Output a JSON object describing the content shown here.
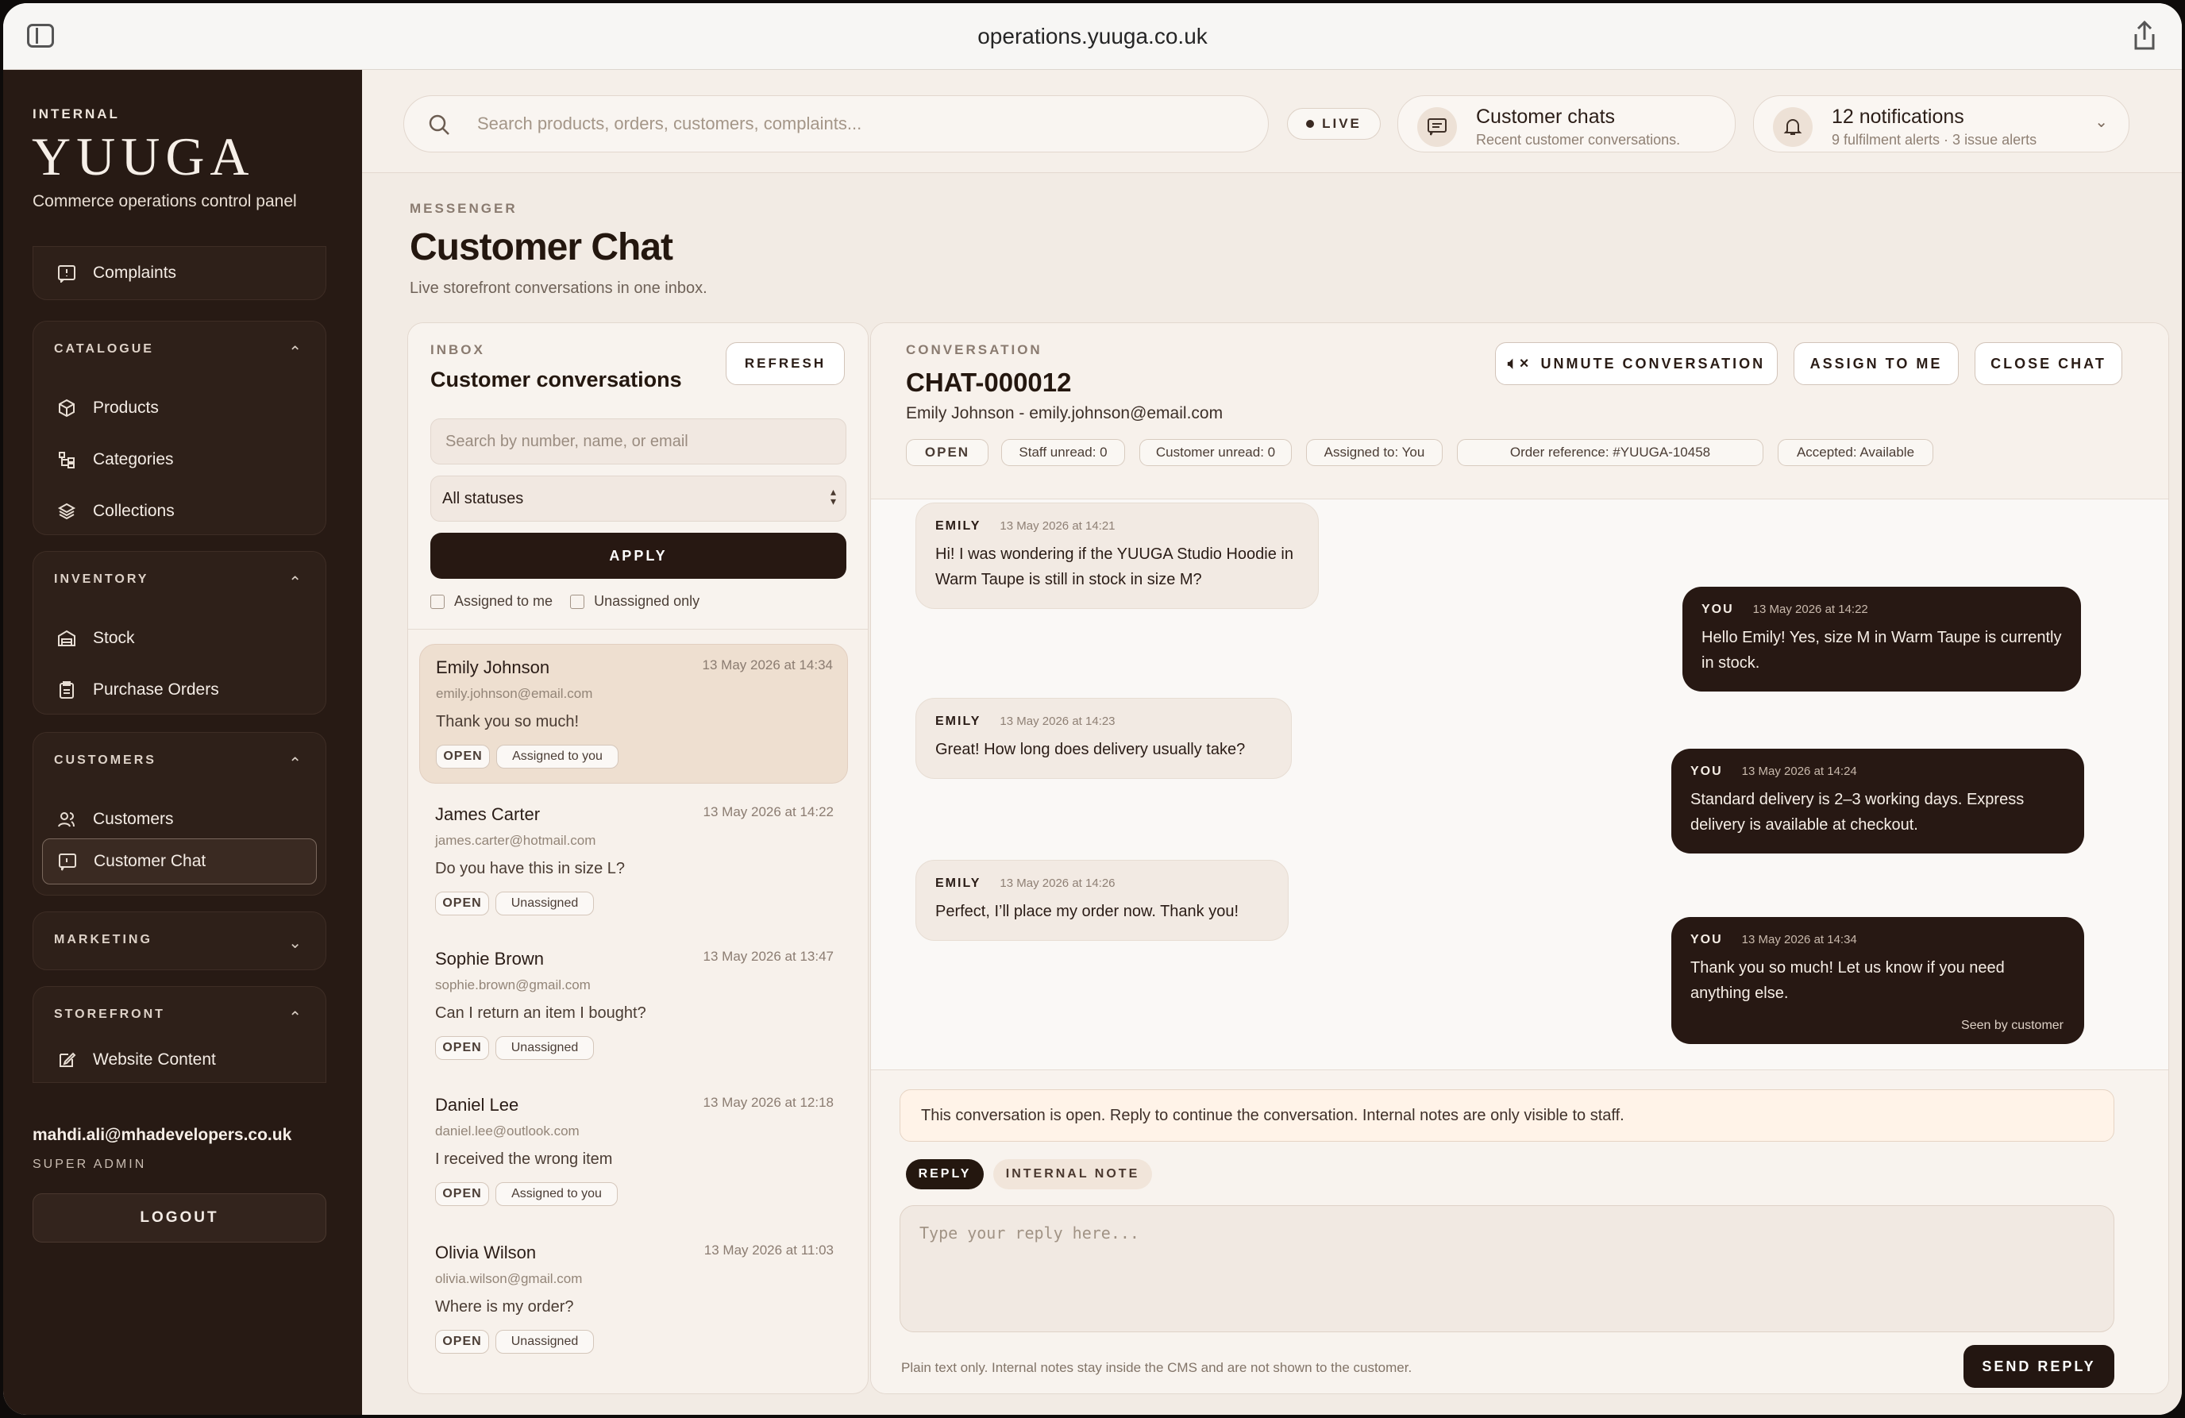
{
  "browser": {
    "url": "operations.yuuga.co.uk"
  },
  "brand": {
    "internal": "INTERNAL",
    "name": "YUUGA",
    "tagline": "Commerce operations control panel"
  },
  "sidebar": {
    "complaints": "Complaints",
    "catalogue": {
      "title": "CATALOGUE",
      "items": [
        "Products",
        "Categories",
        "Collections"
      ]
    },
    "inventory": {
      "title": "INVENTORY",
      "items": [
        "Stock",
        "Purchase Orders"
      ]
    },
    "customers": {
      "title": "CUSTOMERS",
      "items": [
        "Customers",
        "Customer Chat"
      ]
    },
    "marketing": {
      "title": "MARKETING"
    },
    "storefront": {
      "title": "STOREFRONT",
      "items": [
        "Website Content"
      ]
    },
    "user": {
      "email": "mahdi.ali@mhadevelopers.co.uk",
      "role": "SUPER ADMIN"
    },
    "logout": "LOGOUT"
  },
  "topbar": {
    "search_placeholder": "Search products, orders, customers, complaints...",
    "live": "LIVE",
    "chats": {
      "title": "Customer chats",
      "subtitle": "Recent customer conversations."
    },
    "notifications": {
      "title": "12 notifications",
      "subtitle": "9 fulfilment alerts · 3 issue alerts"
    }
  },
  "page": {
    "eyebrow": "MESSENGER",
    "title": "Customer Chat",
    "subtitle": "Live storefront conversations in one inbox."
  },
  "inbox": {
    "eyebrow": "INBOX",
    "title": "Customer conversations",
    "refresh": "REFRESH",
    "search_placeholder": "Search by number, name, or email",
    "status_filter": "All statuses",
    "apply": "APPLY",
    "assigned_to_me": "Assigned to me",
    "unassigned_only": "Unassigned only",
    "conversations": [
      {
        "name": "Emily Johnson",
        "email": "emily.johnson@email.com",
        "time": "13 May 2026 at 14:34",
        "message": "Thank you so much!",
        "status": "OPEN",
        "assignment": "Assigned to you"
      },
      {
        "name": "James Carter",
        "email": "james.carter@hotmail.com",
        "time": "13 May 2026 at 14:22",
        "message": "Do you have this in size L?",
        "status": "OPEN",
        "assignment": "Unassigned"
      },
      {
        "name": "Sophie Brown",
        "email": "sophie.brown@gmail.com",
        "time": "13 May 2026 at 13:47",
        "message": "Can I return an item I bought?",
        "status": "OPEN",
        "assignment": "Unassigned"
      },
      {
        "name": "Daniel Lee",
        "email": "daniel.lee@outlook.com",
        "time": "13 May 2026 at 12:18",
        "message": "I received the wrong item",
        "status": "OPEN",
        "assignment": "Assigned to you"
      },
      {
        "name": "Olivia Wilson",
        "email": "olivia.wilson@gmail.com",
        "time": "13 May 2026 at 11:03",
        "message": "Where is my order?",
        "status": "OPEN",
        "assignment": "Unassigned"
      }
    ]
  },
  "conversation": {
    "eyebrow": "CONVERSATION",
    "id": "CHAT-000012",
    "customer": "Emily Johnson - emily.johnson@email.com",
    "unmute": "UNMUTE CONVERSATION",
    "assign": "ASSIGN TO ME",
    "close": "CLOSE CHAT",
    "tags": [
      "OPEN",
      "Staff unread: 0",
      "Customer unread: 0",
      "Assigned to: You",
      "Order reference: #YUUGA-10458",
      "Accepted: Available"
    ],
    "messages": [
      {
        "from": "EMILY",
        "time": "13 May 2026 at 14:21",
        "text": "Hi! I was wondering if the YUUGA Studio Hoodie in Warm Taupe is still in stock in size M?"
      },
      {
        "from": "YOU",
        "time": "13 May 2026 at 14:22",
        "text": "Hello Emily! Yes, size M in Warm Taupe is currently in stock."
      },
      {
        "from": "EMILY",
        "time": "13 May 2026 at 14:23",
        "text": "Great! How long does delivery usually take?"
      },
      {
        "from": "YOU",
        "time": "13 May 2026 at 14:24",
        "text": "Standard delivery is 2–3 working days. Express delivery is available at checkout."
      },
      {
        "from": "EMILY",
        "time": "13 May 2026 at 14:26",
        "text": "Perfect, I’ll place my order now. Thank you!"
      },
      {
        "from": "YOU",
        "time": "13 May 2026 at 14:34",
        "text": "Thank you so much! Let us know if you need anything else.",
        "seen": "Seen by customer"
      }
    ]
  },
  "composer": {
    "notice": "This conversation is open. Reply to continue the conversation. Internal notes are only visible to staff.",
    "reply_tab": "REPLY",
    "note_tab": "INTERNAL NOTE",
    "placeholder": "Type your reply here...",
    "hint": "Plain text only. Internal notes stay inside the CMS and are not shown to the customer.",
    "send": "SEND REPLY"
  },
  "colors": {
    "sidebar": "#271a14",
    "accent": "#271812",
    "background": "#f2ebe4"
  }
}
